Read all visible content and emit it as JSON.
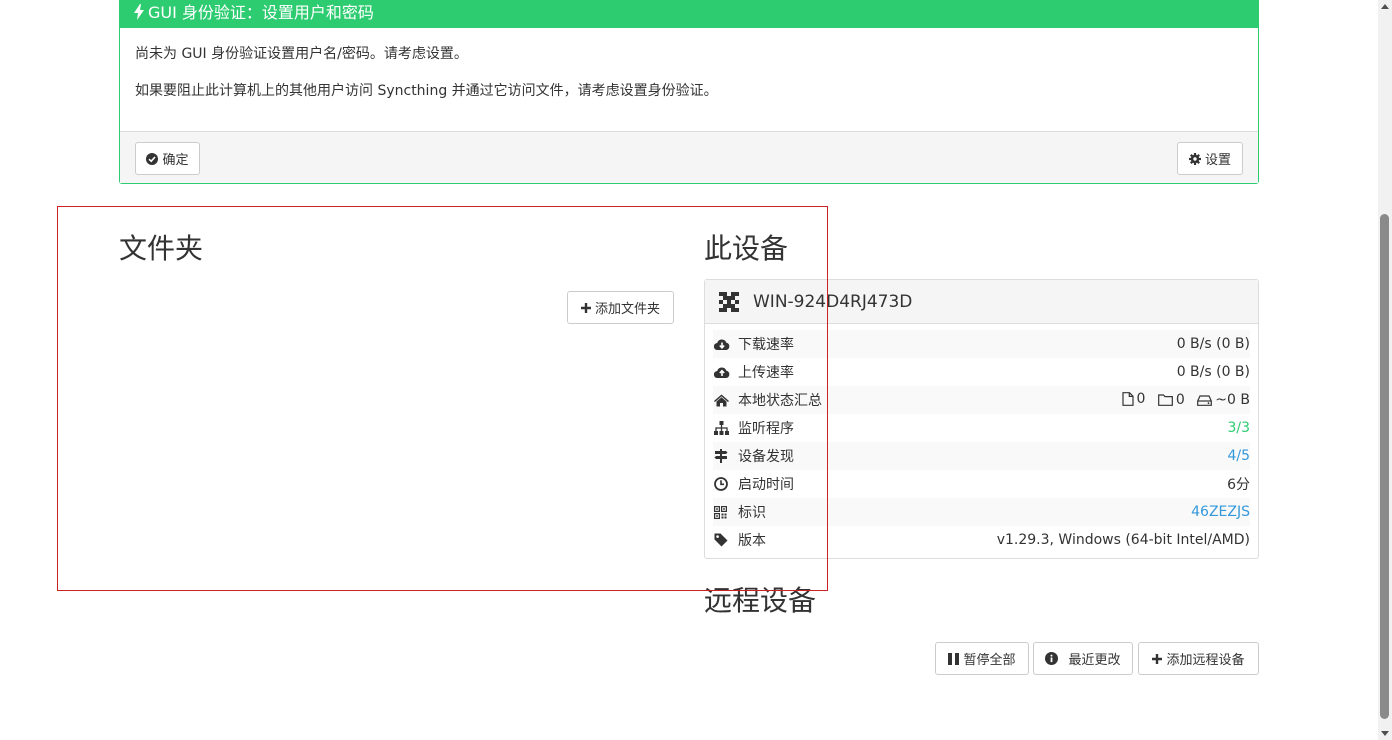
{
  "alert": {
    "title": "GUI 身份验证：设置用户和密码",
    "line1": "尚未为 GUI 身份验证设置用户名/密码。请考虑设置。",
    "line2": "如果要阻止此计算机上的其他用户访问 Syncthing 并通过它访问文件，请考虑设置身份验证。",
    "ok_label": "确定",
    "settings_label": "设置",
    "accent_color": "#2ecc71"
  },
  "folders": {
    "title": "文件夹",
    "add_label": "添加文件夹"
  },
  "this_device": {
    "title": "此设备",
    "name": "WIN-924D4RJ473D",
    "rows": [
      {
        "icon": "cloud-download-icon",
        "label": "下载速率",
        "value": "0 B/s (0 B)"
      },
      {
        "icon": "cloud-upload-icon",
        "label": "上传速率",
        "value": "0 B/s (0 B)"
      },
      {
        "icon": "home-icon",
        "label": "本地状态汇总",
        "files": "0",
        "dirs": "0",
        "size": "~0 B"
      },
      {
        "icon": "sitemap-icon",
        "label": "监听程序",
        "value": "3/3"
      },
      {
        "icon": "signpost-icon",
        "label": "设备发现",
        "value": "4/5"
      },
      {
        "icon": "clock-icon",
        "label": "启动时间",
        "value": "6分"
      },
      {
        "icon": "qrcode-icon",
        "label": "标识",
        "value": "46ZEZJS"
      },
      {
        "icon": "tag-icon",
        "label": "版本",
        "value": "v1.29.3, Windows (64-bit Intel/AMD)"
      }
    ]
  },
  "remote": {
    "title": "远程设备",
    "pause_label": "暂停全部",
    "recent_label": "最近更改",
    "add_label": "添加远程设备"
  }
}
